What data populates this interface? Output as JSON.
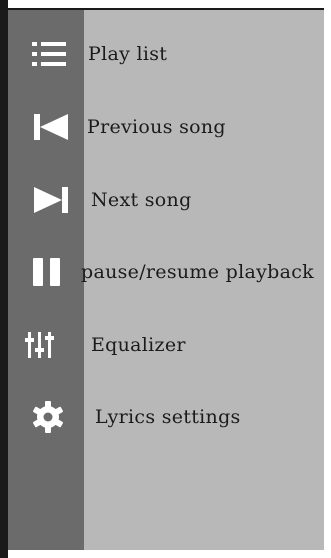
{
  "menu": {
    "items": [
      {
        "label": "Play list",
        "icon": "playlist-icon"
      },
      {
        "label": "Previous song",
        "icon": "skip-previous-icon"
      },
      {
        "label": "Next song",
        "icon": "skip-next-icon"
      },
      {
        "label": "pause/resume playback",
        "icon": "pause-icon"
      },
      {
        "label": "Equalizer",
        "icon": "equalizer-icon"
      },
      {
        "label": "Lyrics settings",
        "icon": "gear-icon"
      }
    ]
  },
  "colors": {
    "icon_rail": "#6b6b6b",
    "label_panel": "#b8b8b8",
    "icon": "#ffffff",
    "text": "#1b1b1b"
  }
}
